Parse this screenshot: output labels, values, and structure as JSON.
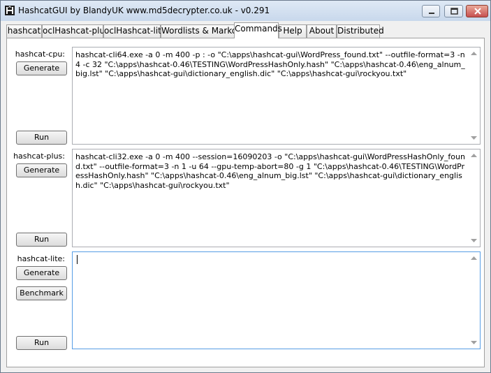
{
  "window": {
    "title": "HashcatGUI by BlandyUK www.md5decrypter.co.uk - v0.291"
  },
  "tabs": [
    {
      "label": "hashcat"
    },
    {
      "label": "oclHashcat-plus"
    },
    {
      "label": "oclHashcat-lite"
    },
    {
      "label": "Wordlists & Markov"
    },
    {
      "label": "Commands"
    },
    {
      "label": "Help"
    },
    {
      "label": "About"
    },
    {
      "label": "Distributed"
    }
  ],
  "active_tab": "Commands",
  "sections": {
    "cpu": {
      "label": "hashcat-cpu:",
      "generate_label": "Generate",
      "run_label": "Run",
      "command": "hashcat-cli64.exe -a 0 -m 400 -p : -o \"C:\\apps\\hashcat-gui\\WordPress_found.txt\" --outfile-format=3 -n 4 -c 32 \"C:\\apps\\hashcat-0.46\\TESTING\\WordPressHashOnly.hash\" \"C:\\apps\\hashcat-0.46\\eng_alnum_big.lst\" \"C:\\apps\\hashcat-gui\\dictionary_english.dic\" \"C:\\apps\\hashcat-gui\\rockyou.txt\""
    },
    "plus": {
      "label": "hashcat-plus:",
      "generate_label": "Generate",
      "run_label": "Run",
      "command": "hashcat-cli32.exe -a 0 -m 400 --session=16090203 -o \"C:\\apps\\hashcat-gui\\WordPressHashOnly_found.txt\" --outfile-format=3 -n 1 -u 64 --gpu-temp-abort=80 -g 1 \"C:\\apps\\hashcat-0.46\\TESTING\\WordPressHashOnly.hash\" \"C:\\apps\\hashcat-0.46\\eng_alnum_big.lst\" \"C:\\apps\\hashcat-gui\\dictionary_english.dic\" \"C:\\apps\\hashcat-gui\\rockyou.txt\""
    },
    "lite": {
      "label": "hashcat-lite:",
      "generate_label": "Generate",
      "benchmark_label": "Benchmark",
      "run_label": "Run",
      "command": ""
    }
  },
  "colors": {
    "accent_focus": "#569de5",
    "close_button": "#c75050"
  }
}
